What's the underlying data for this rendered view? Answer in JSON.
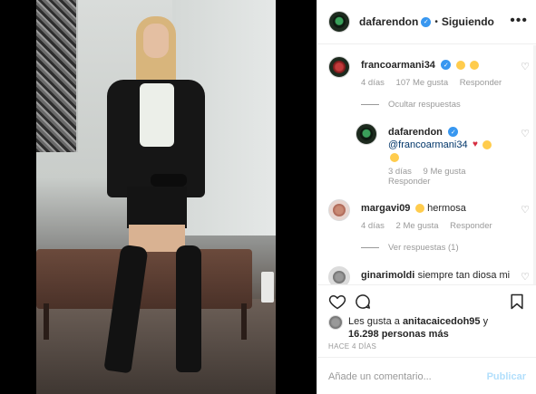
{
  "colors": {
    "verified": "#3897f0",
    "link": "#003569",
    "muted": "#999999",
    "post_disabled": "#b2dffc"
  },
  "header": {
    "username": "dafarendon",
    "separator": "•",
    "follow_status": "Siguiendo",
    "more": "•••"
  },
  "comments": [
    {
      "username": "francoarmani34",
      "text": "",
      "age": "4 días",
      "likes": "107 Me gusta",
      "reply": "Responder"
    },
    {
      "username": "dafarendon",
      "mention": "@francoarmani34",
      "age": "3 días",
      "likes": "9 Me gusta",
      "reply": "Responder"
    },
    {
      "username": "margavi09",
      "text": "hermosa",
      "age": "4 días",
      "likes": "2 Me gusta",
      "reply": "Responder"
    },
    {
      "username": "ginarimoldi",
      "text": "siempre tan diosa mi"
    }
  ],
  "replies": {
    "hide": "Ocultar respuestas",
    "view": "Ver respuestas (1)"
  },
  "likes": {
    "prefix": "Les gusta a",
    "user": "anitacaicedoh95",
    "and": "y",
    "count": "16.298 personas más"
  },
  "timestamp": "HACE 4 DÍAS",
  "input": {
    "placeholder": "Añade un comentario...",
    "post": "Publicar"
  },
  "icons": [
    "more-icon",
    "heart-icon",
    "comment-icon",
    "bookmark-icon",
    "verified-icon"
  ]
}
